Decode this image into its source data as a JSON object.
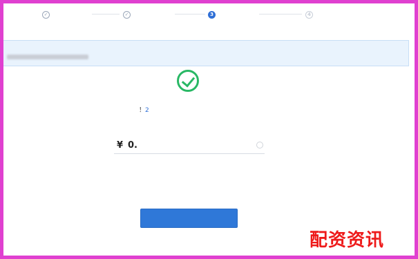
{
  "stepper": {
    "steps": [
      {
        "label": "  ",
        "icon": "check-circle-icon",
        "state": "done"
      },
      {
        "label": "  ",
        "icon": "check-circle-icon",
        "state": "done"
      },
      {
        "label": "",
        "icon": "3",
        "state": "active"
      },
      {
        "label": "",
        "icon": "4",
        "state": "pending"
      }
    ]
  },
  "banner": {
    "prefix": "",
    "title": "",
    "line2_prefix": "",
    "line2_suffix": "",
    "link": ""
  },
  "success": {
    "text_before": "！",
    "highlight": "2",
    "text_after": ""
  },
  "amount": {
    "label": "",
    "currency": "¥",
    "value": "0.",
    "input_placeholder": ""
  },
  "note": "",
  "confirm_button": "",
  "watermark": "配资资讯",
  "colors": {
    "accent": "#2f6fd6",
    "success": "#29b865",
    "border": "#e040d0",
    "watermark": "#ee1a1a"
  }
}
